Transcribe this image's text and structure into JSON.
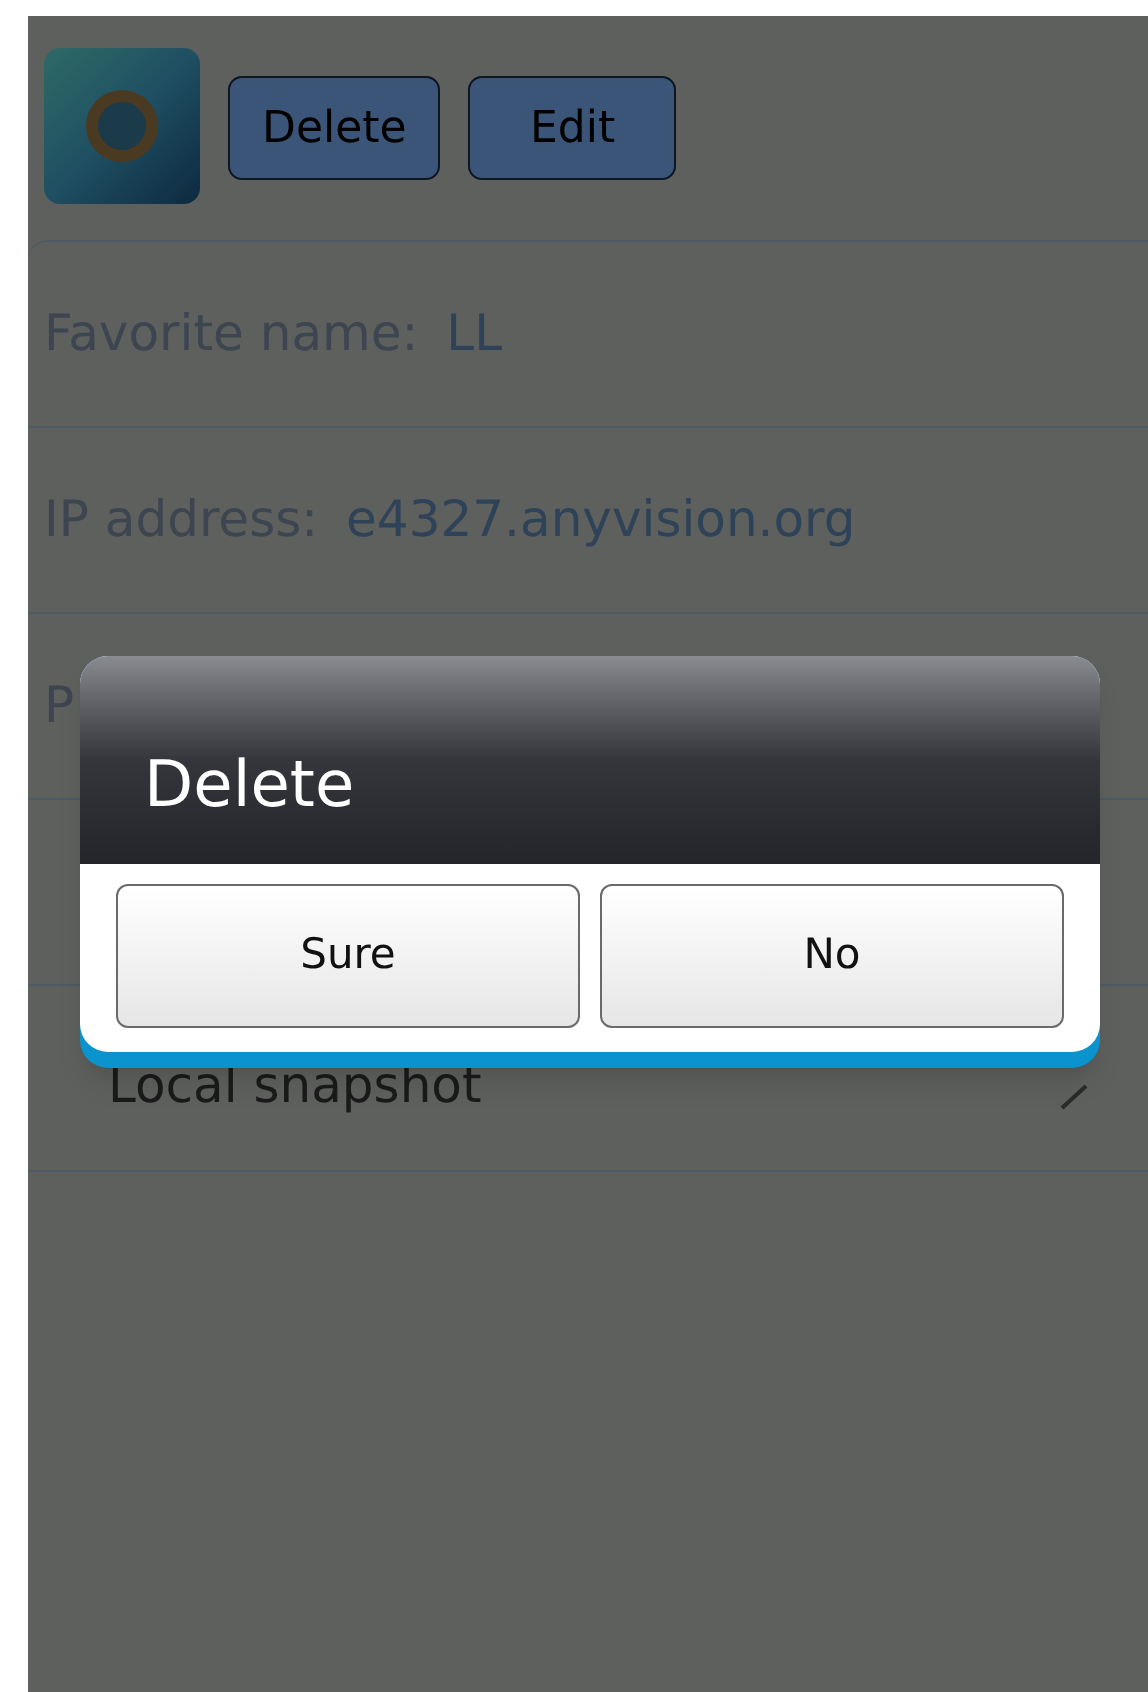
{
  "toolbar": {
    "buttons": [
      "Delete",
      "Edit"
    ]
  },
  "rows": [
    {
      "kind": "field",
      "label": "Favorite name:",
      "value": "LL"
    },
    {
      "kind": "field",
      "label": "IP address:",
      "value": "e4327.anyvision.org"
    },
    {
      "kind": "field",
      "label": "P"
    },
    {
      "kind": "blank"
    },
    {
      "kind": "link",
      "label": "Local snapshot"
    }
  ],
  "dialog": {
    "title": "Delete",
    "buttons": [
      "Sure",
      "No"
    ]
  }
}
